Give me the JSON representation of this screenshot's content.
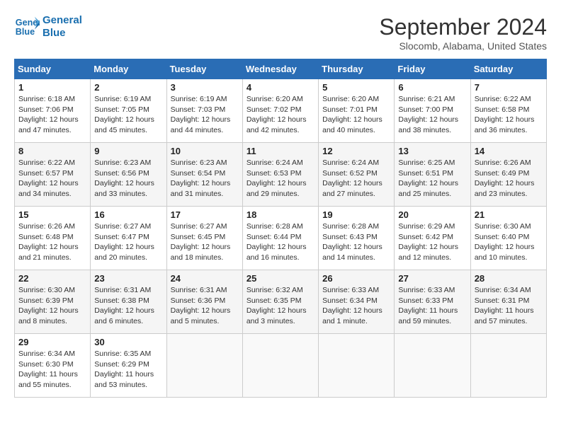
{
  "logo": {
    "line1": "General",
    "line2": "Blue"
  },
  "title": "September 2024",
  "location": "Slocomb, Alabama, United States",
  "weekdays": [
    "Sunday",
    "Monday",
    "Tuesday",
    "Wednesday",
    "Thursday",
    "Friday",
    "Saturday"
  ],
  "weeks": [
    [
      {
        "day": "1",
        "info": "Sunrise: 6:18 AM\nSunset: 7:06 PM\nDaylight: 12 hours\nand 47 minutes."
      },
      {
        "day": "2",
        "info": "Sunrise: 6:19 AM\nSunset: 7:05 PM\nDaylight: 12 hours\nand 45 minutes."
      },
      {
        "day": "3",
        "info": "Sunrise: 6:19 AM\nSunset: 7:03 PM\nDaylight: 12 hours\nand 44 minutes."
      },
      {
        "day": "4",
        "info": "Sunrise: 6:20 AM\nSunset: 7:02 PM\nDaylight: 12 hours\nand 42 minutes."
      },
      {
        "day": "5",
        "info": "Sunrise: 6:20 AM\nSunset: 7:01 PM\nDaylight: 12 hours\nand 40 minutes."
      },
      {
        "day": "6",
        "info": "Sunrise: 6:21 AM\nSunset: 7:00 PM\nDaylight: 12 hours\nand 38 minutes."
      },
      {
        "day": "7",
        "info": "Sunrise: 6:22 AM\nSunset: 6:58 PM\nDaylight: 12 hours\nand 36 minutes."
      }
    ],
    [
      {
        "day": "8",
        "info": "Sunrise: 6:22 AM\nSunset: 6:57 PM\nDaylight: 12 hours\nand 34 minutes."
      },
      {
        "day": "9",
        "info": "Sunrise: 6:23 AM\nSunset: 6:56 PM\nDaylight: 12 hours\nand 33 minutes."
      },
      {
        "day": "10",
        "info": "Sunrise: 6:23 AM\nSunset: 6:54 PM\nDaylight: 12 hours\nand 31 minutes."
      },
      {
        "day": "11",
        "info": "Sunrise: 6:24 AM\nSunset: 6:53 PM\nDaylight: 12 hours\nand 29 minutes."
      },
      {
        "day": "12",
        "info": "Sunrise: 6:24 AM\nSunset: 6:52 PM\nDaylight: 12 hours\nand 27 minutes."
      },
      {
        "day": "13",
        "info": "Sunrise: 6:25 AM\nSunset: 6:51 PM\nDaylight: 12 hours\nand 25 minutes."
      },
      {
        "day": "14",
        "info": "Sunrise: 6:26 AM\nSunset: 6:49 PM\nDaylight: 12 hours\nand 23 minutes."
      }
    ],
    [
      {
        "day": "15",
        "info": "Sunrise: 6:26 AM\nSunset: 6:48 PM\nDaylight: 12 hours\nand 21 minutes."
      },
      {
        "day": "16",
        "info": "Sunrise: 6:27 AM\nSunset: 6:47 PM\nDaylight: 12 hours\nand 20 minutes."
      },
      {
        "day": "17",
        "info": "Sunrise: 6:27 AM\nSunset: 6:45 PM\nDaylight: 12 hours\nand 18 minutes."
      },
      {
        "day": "18",
        "info": "Sunrise: 6:28 AM\nSunset: 6:44 PM\nDaylight: 12 hours\nand 16 minutes."
      },
      {
        "day": "19",
        "info": "Sunrise: 6:28 AM\nSunset: 6:43 PM\nDaylight: 12 hours\nand 14 minutes."
      },
      {
        "day": "20",
        "info": "Sunrise: 6:29 AM\nSunset: 6:42 PM\nDaylight: 12 hours\nand 12 minutes."
      },
      {
        "day": "21",
        "info": "Sunrise: 6:30 AM\nSunset: 6:40 PM\nDaylight: 12 hours\nand 10 minutes."
      }
    ],
    [
      {
        "day": "22",
        "info": "Sunrise: 6:30 AM\nSunset: 6:39 PM\nDaylight: 12 hours\nand 8 minutes."
      },
      {
        "day": "23",
        "info": "Sunrise: 6:31 AM\nSunset: 6:38 PM\nDaylight: 12 hours\nand 6 minutes."
      },
      {
        "day": "24",
        "info": "Sunrise: 6:31 AM\nSunset: 6:36 PM\nDaylight: 12 hours\nand 5 minutes."
      },
      {
        "day": "25",
        "info": "Sunrise: 6:32 AM\nSunset: 6:35 PM\nDaylight: 12 hours\nand 3 minutes."
      },
      {
        "day": "26",
        "info": "Sunrise: 6:33 AM\nSunset: 6:34 PM\nDaylight: 12 hours\nand 1 minute."
      },
      {
        "day": "27",
        "info": "Sunrise: 6:33 AM\nSunset: 6:33 PM\nDaylight: 11 hours\nand 59 minutes."
      },
      {
        "day": "28",
        "info": "Sunrise: 6:34 AM\nSunset: 6:31 PM\nDaylight: 11 hours\nand 57 minutes."
      }
    ],
    [
      {
        "day": "29",
        "info": "Sunrise: 6:34 AM\nSunset: 6:30 PM\nDaylight: 11 hours\nand 55 minutes."
      },
      {
        "day": "30",
        "info": "Sunrise: 6:35 AM\nSunset: 6:29 PM\nDaylight: 11 hours\nand 53 minutes."
      },
      {
        "day": "",
        "info": ""
      },
      {
        "day": "",
        "info": ""
      },
      {
        "day": "",
        "info": ""
      },
      {
        "day": "",
        "info": ""
      },
      {
        "day": "",
        "info": ""
      }
    ]
  ]
}
